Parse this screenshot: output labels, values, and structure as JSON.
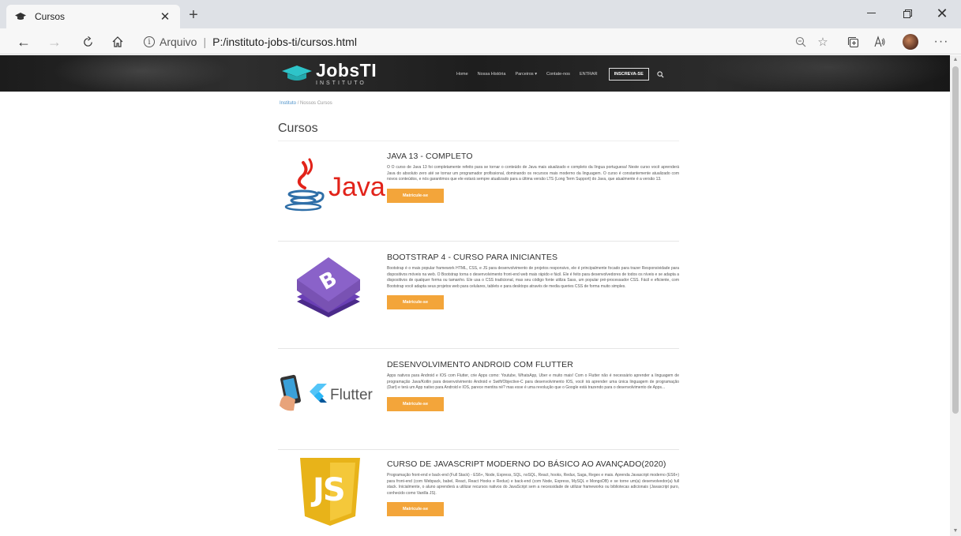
{
  "browser": {
    "tab_title": "Cursos",
    "new_tab_symbol": "+",
    "url_prefix": "Arquivo",
    "url": "P:/instituto-jobs-ti/cursos.html"
  },
  "site": {
    "logo_main": "JobsTI",
    "logo_sub": "INSTITUTO",
    "nav": [
      {
        "label": "Home"
      },
      {
        "label": "Nossa História"
      },
      {
        "label": "Parceiros ▾"
      },
      {
        "label": "Contate-nos"
      },
      {
        "label": "ENTRAR"
      }
    ],
    "cta_label": "INSCREVA-SE"
  },
  "breadcrumb": {
    "root": "Instituto",
    "separator": "/",
    "current": "Nossos Cursos"
  },
  "page_title": "Cursos",
  "courses": [
    {
      "title": "JAVA 13 - COMPLETO",
      "description": "O O curso de Java 13 foi completamente refeito para se tornar o conteúdo de Java mais atualizado e completo da língua portuguesa! Neste curso você aprenderá Java do absoluto zero até se tornar um programador profissional, dominando os recursos mais moderno da linguagem. O curso é constantemente atualizado com novos conteúdos, e nós garantimos que ele estará sempre atualizado para a última versão LTS (Long Term Support) do Java, que atualmente é a versão 13.",
      "button": "Matricule-se",
      "image_text": "Java",
      "image_icon": "java-cup-icon"
    },
    {
      "title": "BOOTSTRAP 4 - CURSO PARA INICIANTES",
      "description": "Bootstrap é o mais popular framework HTML, CSS, e JS para desenvolvimento de projetos responsivo, ele é principalmente focado para trazer Responsividade para dispositivos móveis na web. O Bootstrap torna o desenvolvimento front-end web mais rápido e fácil. Ele é feito para desenvolvedores de todos os níveis e se adapta a dispositivos de qualquer forma ou tamanho. Ele usa o CSS tradicional, mas seu código fonte utiliza Sass, um popular pré-processador CSS. Fácil e eficiente, com Bootstrap você adapta seus projetos web para celulares, tablets e para desktops através de media queries CSS de forma muito simples.",
      "button": "Matricule-se",
      "image_icon": "bootstrap-logo-icon"
    },
    {
      "title": "DESENVOLVIMENTO ANDROID COM FLUTTER",
      "description": "Apps nativos para Android e IOS com Flutter, crie Apps como: Youtube, WhatsApp, Uber e muito mais! Com o Flutter não é necessário aprender a linguagem de programação Java/Kotlin para desenvolvimento Android e Swift/Objective-C para desenvolvimento IOS, você irá aprender uma única linguagem de programação (Dart) e terá um App nativo para Android e IOS, parece mentira né? mas esse é uma revolução que o Google está trazendo para o desenvolvimento de Apps...",
      "button": "Matricule-se",
      "image_text": "Flutter",
      "image_icon": "flutter-logo-icon"
    },
    {
      "title": "CURSO DE JAVASCRIPT MODERNO DO BÁSICO AO AVANÇADO(2020)",
      "description": "Programação front-end e back-end (Full Stack) - ES6+, Node, Express, SQL, noSQL, React, hooks, Redux, Saga, Regex e mais. Aprenda Javascript moderno (ES6+) para front-end (com Webpack, babel, React, React Hooks e Redux) e back-end (com Node, Express, MySQL e MongoDB) e se torne um(a) desenvolvedor(a) full stack. Inicialmente, o aluno aprenderá a utilizar recursos nativos do JavaScript sem a necessidade de utilizar frameworks ou bibliotecas adicionais (Javascript puro, conhecido como Vanilla JS).",
      "button": "Matricule-se",
      "image_text": "JS",
      "image_icon": "javascript-shield-icon"
    }
  ],
  "colors": {
    "accent_button": "#f3a53a",
    "header_bg": "#222222",
    "logo_cap": "#2ec4c9",
    "breadcrumb_link": "#4a90c8"
  }
}
